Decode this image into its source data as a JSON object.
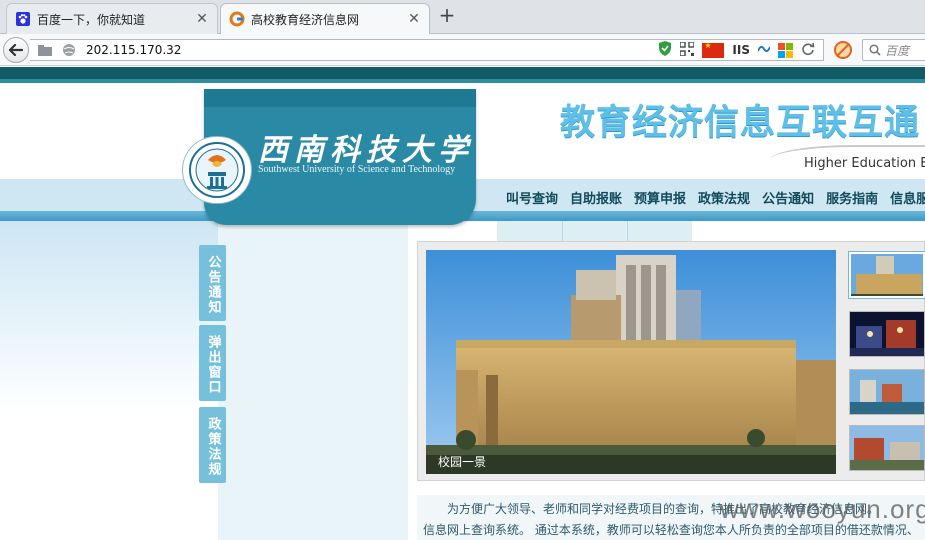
{
  "browser": {
    "tabs": [
      {
        "title": "百度一下，你就知道",
        "icon": "baidu-paw-icon",
        "active": false
      },
      {
        "title": "高校教育经济信息网",
        "icon": "site-g-icon",
        "active": true
      }
    ],
    "new_tab_symbol": "+",
    "close_symbol": "✕",
    "url": "202.115.170.32",
    "iis_label": "IIS",
    "search_placeholder": "百度"
  },
  "site": {
    "university_name": "西南科技大学",
    "university_name_en": "Southwest University of Science and Technology",
    "slogan": "教育经济信息互联互通",
    "slogan_en": "Higher Education Ec",
    "menu": [
      "叫号查询",
      "自助报账",
      "预算申报",
      "政策法规",
      "公告通知",
      "服务指南",
      "信息服务"
    ],
    "side_tabs": [
      "公告通知",
      "弹出窗口",
      "政策法规"
    ],
    "slideshow": {
      "caption": "校园一景",
      "thumb_count": 4
    },
    "intro_line1": "为方便广大领导、老师和同学对经费项目的查询，特推出了高校教育经济信息网。",
    "intro_line2": "信息网上查询系统。 通过本系统，教师可以轻松查询您本人所负责的全部项目的借还款情况、",
    "watermark": "www.wooyun.org"
  },
  "colors": {
    "top_band": "#135a67",
    "logo_panel": "#2a8aa6",
    "menu_text": "#114a5a",
    "side_tab": "#76c0dc",
    "slogan": "#5ec0e8"
  }
}
